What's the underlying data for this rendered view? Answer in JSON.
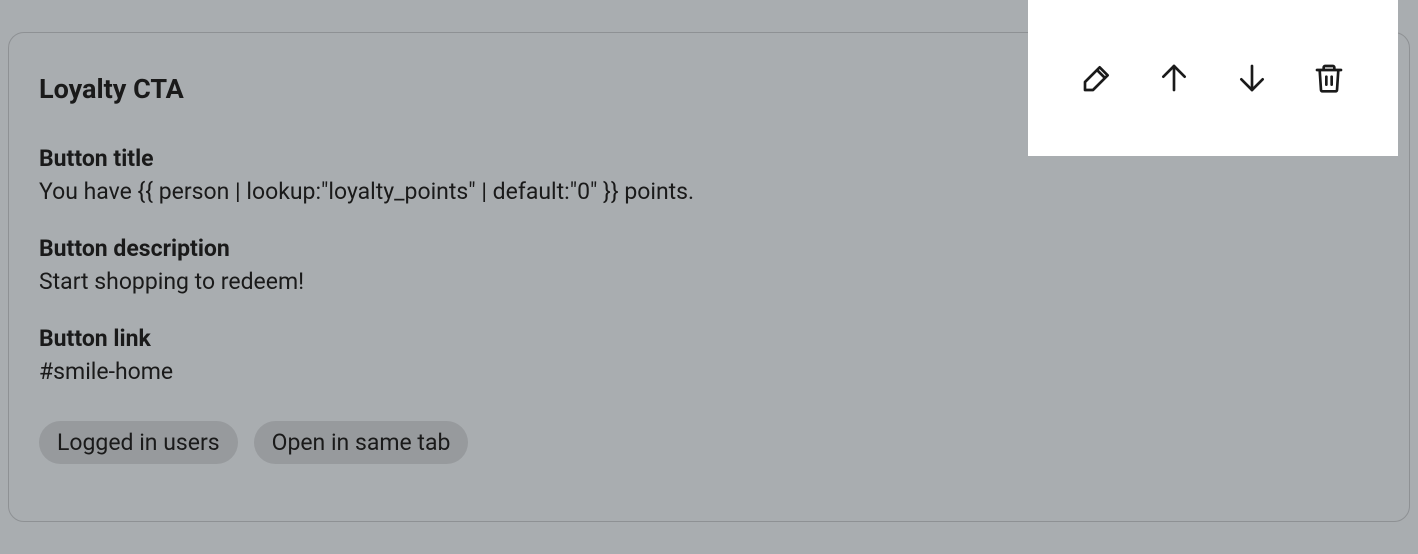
{
  "card": {
    "title": "Loyalty CTA",
    "fields": {
      "button_title": {
        "label": "Button title",
        "value": "You have {{ person | lookup:\"loyalty_points\" | default:\"0\" }} points."
      },
      "button_description": {
        "label": "Button description",
        "value": "Start shopping to redeem!"
      },
      "button_link": {
        "label": "Button link",
        "value": "#smile-home"
      }
    },
    "tags": [
      "Logged in users",
      "Open in same tab"
    ]
  },
  "toolbar": {
    "edit": "edit",
    "move_up": "move-up",
    "move_down": "move-down",
    "delete": "delete"
  }
}
